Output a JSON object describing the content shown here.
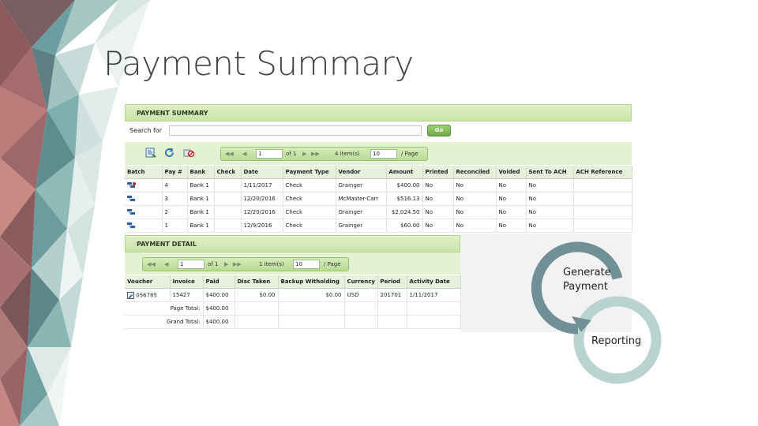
{
  "slide": {
    "title": "Payment Summary"
  },
  "summary": {
    "header": "PAYMENT SUMMARY",
    "search_label": "Search for",
    "search_value": "",
    "go_label": "Go",
    "pager": {
      "first": "◀◀",
      "prev": "◀",
      "page": "1",
      "of": "of 1",
      "next": "▶",
      "last": "▶▶",
      "items": "4 item(s)",
      "per_page_value": "10",
      "per_page_label": "/ Page"
    },
    "columns": [
      "Batch",
      "Pay #",
      "Bank",
      "Check",
      "Date",
      "Payment Type",
      "Vendor",
      "Amount",
      "Printed",
      "Reconciled",
      "Voided",
      "Sent To ACH",
      "ACH Reference"
    ],
    "rows": [
      {
        "pay": "4",
        "bank": "Bank 1",
        "check": "",
        "date": "1/11/2017",
        "type": "Check",
        "vendor": "Grainger",
        "amount": "$400.00",
        "printed": "No",
        "reconciled": "No",
        "voided": "No",
        "ach": "No",
        "ach_ref": ""
      },
      {
        "pay": "3",
        "bank": "Bank 1",
        "check": "",
        "date": "12/20/2016",
        "type": "Check",
        "vendor": "McMaster-Carr",
        "amount": "$516.13",
        "printed": "No",
        "reconciled": "No",
        "voided": "No",
        "ach": "No",
        "ach_ref": ""
      },
      {
        "pay": "2",
        "bank": "Bank 1",
        "check": "",
        "date": "12/20/2016",
        "type": "Check",
        "vendor": "Grainger",
        "amount": "$2,024.50",
        "printed": "No",
        "reconciled": "No",
        "voided": "No",
        "ach": "No",
        "ach_ref": ""
      },
      {
        "pay": "1",
        "bank": "Bank 1",
        "check": "",
        "date": "12/9/2016",
        "type": "Check",
        "vendor": "Grainger",
        "amount": "$60.00",
        "printed": "No",
        "reconciled": "No",
        "voided": "No",
        "ach": "No",
        "ach_ref": ""
      }
    ]
  },
  "detail": {
    "header": "PAYMENT DETAIL",
    "pager": {
      "first": "◀◀",
      "prev": "◀",
      "page": "1",
      "of": "of 1",
      "next": "▶",
      "last": "▶▶",
      "items": "1 item(s)",
      "per_page_value": "10",
      "per_page_label": "/ Page"
    },
    "columns": [
      "Voucher",
      "Invoice",
      "Paid",
      "Disc Taken",
      "Backup Witholding",
      "Currency",
      "Period",
      "Activity Date"
    ],
    "row": {
      "voucher": "056785",
      "invoice": "15427",
      "paid": "$400.00",
      "disc": "$0.00",
      "backup": "$0.00",
      "currency": "USD",
      "period": "201701",
      "activity": "1/11/2017"
    },
    "page_total_label": "Page Total:",
    "page_total": "$400.00",
    "grand_total_label": "Grand Total:",
    "grand_total": "$400.00"
  },
  "cycle": {
    "step1": "Generate\nPayment",
    "step2": "Reporting",
    "color_dark": "#708f96",
    "color_light": "#b9d3d0"
  }
}
